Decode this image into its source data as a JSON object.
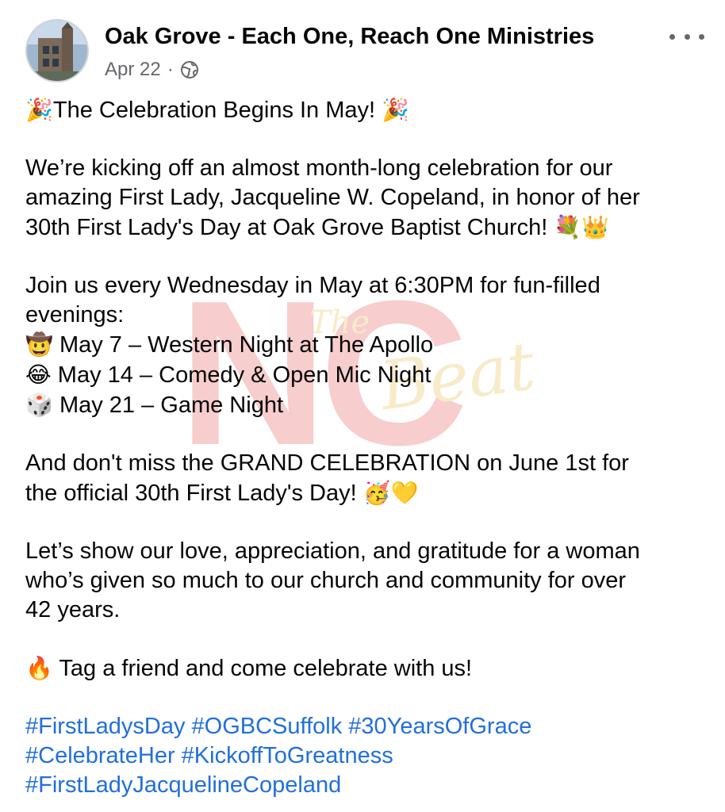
{
  "post": {
    "page_name": "Oak Grove - Each One, Reach One Ministries",
    "date": "Apr 22",
    "separator": "·",
    "privacy_icon": "globe-icon",
    "more_icon": "more-options-icon",
    "title": {
      "emoji_left": "🎉",
      "text": "The Celebration Begins In May!",
      "emoji_right": "🎉"
    },
    "intro": {
      "lines": [
        "We’re kicking off an almost month-long celebration for our",
        "amazing First Lady, Jacqueline W. Copeland, in honor of her",
        "30th First Lady's Day at Oak Grove Baptist Church!"
      ],
      "emoji": "💐👑"
    },
    "schedule": {
      "lines": [
        "Join us every Wednesday in May at 6:30PM for fun-filled",
        "evenings:"
      ],
      "events": [
        {
          "emoji": "🤠",
          "text": "May 7 – Western Night at The Apollo"
        },
        {
          "emoji": "😂",
          "text": "May 14 – Comedy & Open Mic Night"
        },
        {
          "emoji": "🎲",
          "text": "May 21 – Game Night"
        }
      ]
    },
    "grand": {
      "lines": [
        "And don't miss the GRAND CELEBRATION on June 1st for",
        "the official 30th First Lady's Day!"
      ],
      "emoji": "🥳💛"
    },
    "closing": {
      "lines": [
        "Let’s show our love, appreciation, and gratitude for a woman",
        "who’s given so much to our church and community for over",
        "42 years."
      ]
    },
    "cta": {
      "emoji": "🔥",
      "text": "Tag a friend and come celebrate with us!"
    },
    "hashtags": [
      "#FirstLadysDay",
      "#OGBCSuffolk",
      "#30YearsOfGrace",
      "#CelebrateHer",
      "#KickoffToGreatness",
      "#FirstLadyJacquelineCopeland"
    ]
  },
  "watermark": {
    "logo_text": "The Beat"
  },
  "colors": {
    "text": "#050505",
    "secondary": "#65676b",
    "link": "#216fdb",
    "watermark_red": "#f2a6a6",
    "watermark_gold": "#f3dba0"
  }
}
